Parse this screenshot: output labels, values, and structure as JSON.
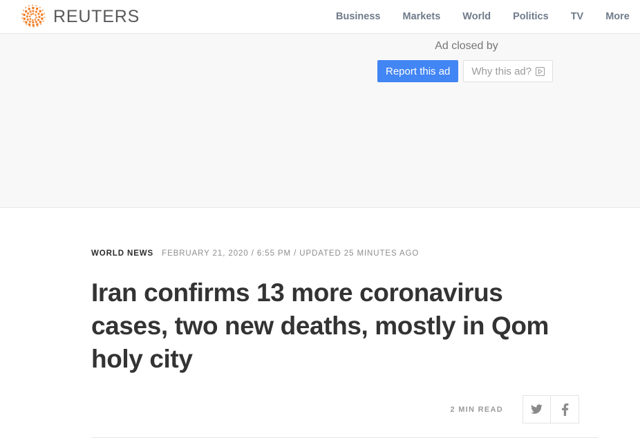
{
  "header": {
    "brand_name": "REUTERS",
    "brand_logo_icon": "reuters-dot-circle-logo",
    "brand_color": "#f07c22",
    "wordmark_color": "#58595b",
    "nav": [
      {
        "label": "Business"
      },
      {
        "label": "Markets"
      },
      {
        "label": "World"
      },
      {
        "label": "Politics"
      },
      {
        "label": "TV"
      },
      {
        "label": "More"
      }
    ]
  },
  "ad": {
    "closed_label": "Ad closed by",
    "report_button_label": "Report this ad",
    "why_button_label": "Why this ad?",
    "why_button_icon": "adchoices-triangle-icon",
    "report_button_color": "#4285f4",
    "background_color": "#f8f8f8"
  },
  "article": {
    "section_kicker": "WORLD NEWS",
    "meta": "FEBRUARY 21, 2020 / 6:55 PM / UPDATED 25 MINUTES AGO",
    "headline": "Iran confirms 13 more coronavirus cases, two new deaths, mostly in Qom holy city",
    "read_time": "2 MIN READ",
    "share": [
      {
        "name": "twitter",
        "icon": "twitter-bird-icon"
      },
      {
        "name": "facebook",
        "icon": "facebook-f-icon"
      }
    ]
  }
}
